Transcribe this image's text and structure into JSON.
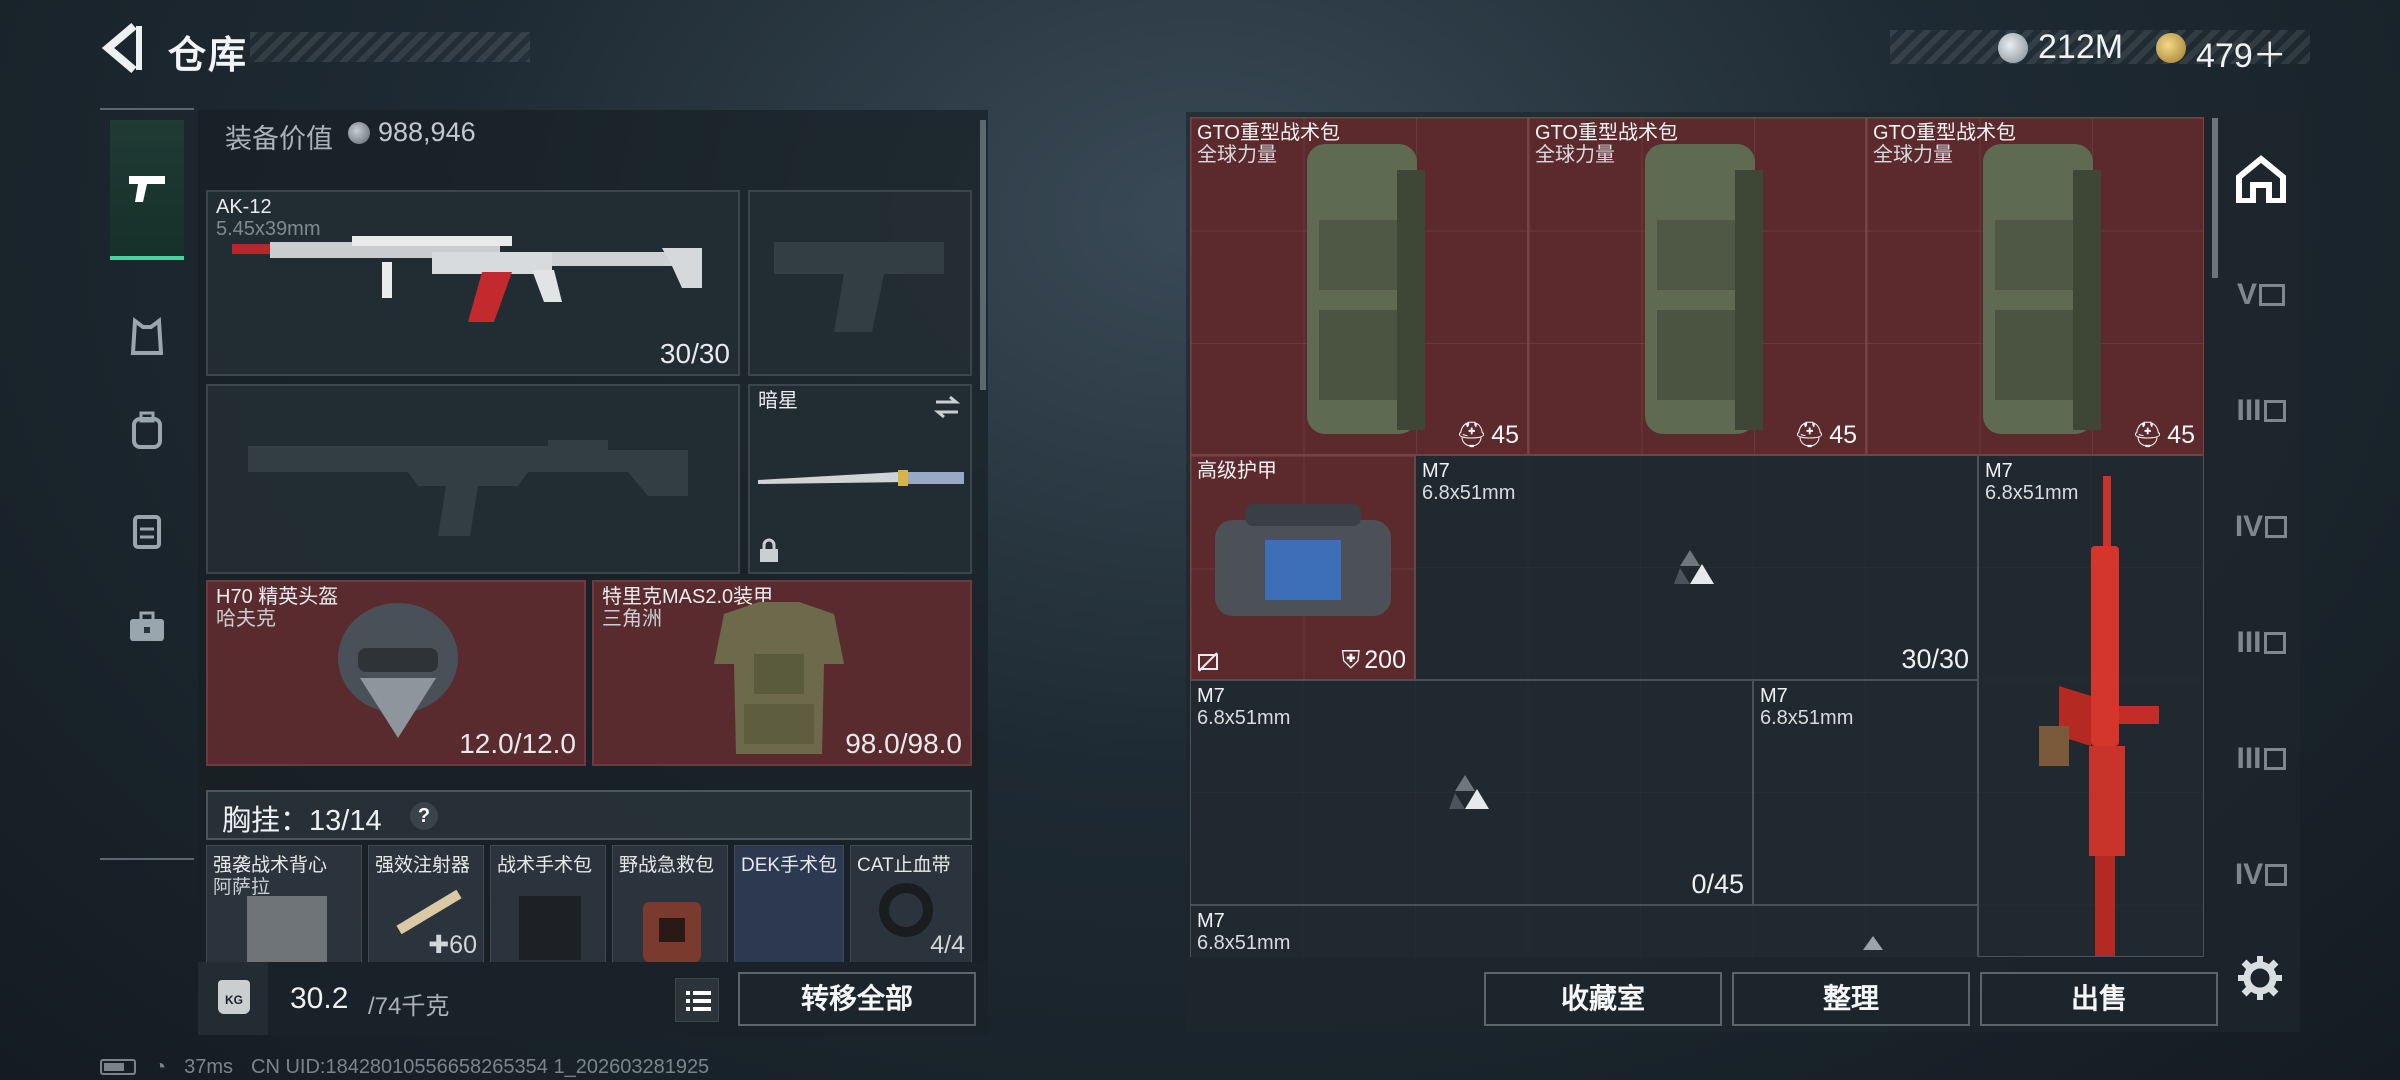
{
  "header": {
    "title": "仓库",
    "currency_1": "212M",
    "currency_2": "479＋"
  },
  "left_nav": {
    "items": [
      {
        "name": "weapons",
        "icon": "pistol-icon"
      },
      {
        "name": "armor",
        "icon": "vest-icon"
      },
      {
        "name": "backpack",
        "icon": "backpack-icon"
      },
      {
        "name": "rig",
        "icon": "chest-rig-icon"
      },
      {
        "name": "case",
        "icon": "briefcase-icon"
      }
    ]
  },
  "equipment": {
    "value_label": "装备价值",
    "value": "988,946",
    "primary": {
      "name": "AK-12",
      "caliber": "5.45x39mm",
      "ammo": "30/30"
    },
    "melee": {
      "name": "暗星"
    },
    "helmet": {
      "name": "H70 精英头盔",
      "sub": "哈夫克",
      "durability": "12.0/12.0"
    },
    "armor": {
      "name": "特里克MAS2.0装甲",
      "sub": "三角洲",
      "durability": "98.0/98.0"
    }
  },
  "chest_rig": {
    "label": "胸挂：13/14",
    "help": "?",
    "items": [
      {
        "title": "强袭战术背心",
        "sub": "阿萨拉",
        "count": ""
      },
      {
        "title": "强效注射器",
        "sub": "",
        "count": "✚60"
      },
      {
        "title": "战术手术包",
        "sub": "",
        "count": ""
      },
      {
        "title": "野战急救包",
        "sub": "",
        "count": ""
      },
      {
        "title": "DEK手术包",
        "sub": "",
        "count": ""
      },
      {
        "title": "CAT止血带",
        "sub": "",
        "count": "4/4"
      }
    ]
  },
  "weight": {
    "current": "30.2",
    "max": "/74千克",
    "icon_text": "KG"
  },
  "buttons": {
    "transfer_all": "转移全部",
    "collection": "收藏室",
    "sort": "整理",
    "sell": "出售"
  },
  "storage_grid": {
    "backpacks": [
      {
        "title": "GTO重型战术包",
        "sub": "全球力量",
        "weight": "45"
      },
      {
        "title": "GTO重型战术包",
        "sub": "全球力量",
        "weight": "45"
      },
      {
        "title": "GTO重型战术包",
        "sub": "全球力量",
        "weight": "45"
      }
    ],
    "armor_bag": {
      "title": "高级护甲",
      "value": "200"
    },
    "m7_a": {
      "title": "M7",
      "sub": "6.8x51mm",
      "count": "30/30"
    },
    "m7_b": {
      "title": "M7",
      "sub": "6.8x51mm"
    },
    "m7_c": {
      "title": "M7",
      "sub": "6.8x51mm",
      "count": "0/45"
    },
    "m7_d": {
      "title": "M7",
      "sub": "6.8x51mm"
    },
    "m7_e": {
      "title": "M7",
      "sub": "6.8x51mm"
    }
  },
  "right_tabs": [
    "V",
    "III",
    "IV",
    "III",
    "III",
    "IV"
  ],
  "status": {
    "ping": "37ms",
    "uid": "CN UID:18428010556658265354 1_202603281925"
  },
  "colors": {
    "accent_green": "#49d49c",
    "red_item": "#5a2b2e",
    "rifle_red": "#d4362c"
  }
}
